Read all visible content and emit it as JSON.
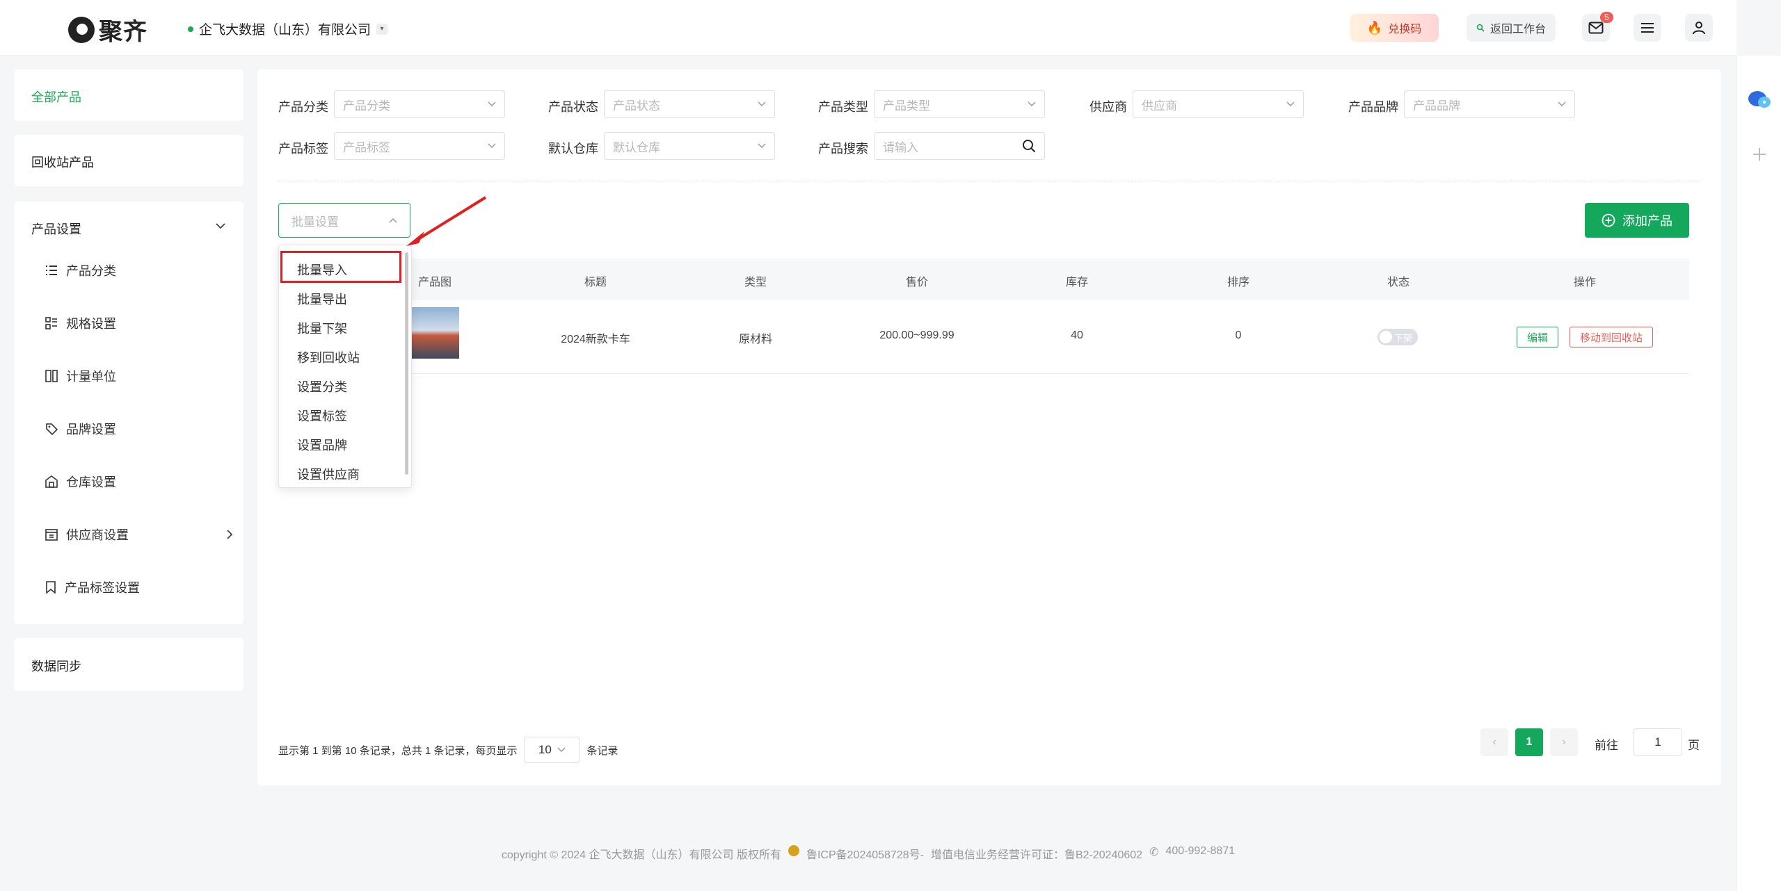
{
  "header": {
    "logo_text": "聚齐",
    "company": "企飞大数据（山东）有限公司",
    "redeem_label": "兑换码",
    "back_label": "返回工作台",
    "mail_badge": "5",
    "icons": [
      "flame-icon",
      "search-icon",
      "mail-icon",
      "menu-icon",
      "user-icon"
    ]
  },
  "sidebar": {
    "all_products": "全部产品",
    "recycle_products": "回收站产品",
    "product_settings": "产品设置",
    "settings_items": [
      {
        "label": "产品分类",
        "icon": "list-icon"
      },
      {
        "label": "规格设置",
        "icon": "spec-icon"
      },
      {
        "label": "计量单位",
        "icon": "unit-icon"
      },
      {
        "label": "品牌设置",
        "icon": "tag-icon"
      },
      {
        "label": "仓库设置",
        "icon": "warehouse-icon"
      },
      {
        "label": "供应商设置",
        "icon": "supplier-icon"
      },
      {
        "label": "产品标签设置",
        "icon": "bookmark-icon"
      }
    ],
    "data_sync": "数据同步",
    "active_color": "#1aaa55"
  },
  "filters": {
    "category": {
      "label": "产品分类",
      "placeholder": "产品分类"
    },
    "status": {
      "label": "产品状态",
      "placeholder": "产品状态"
    },
    "type": {
      "label": "产品类型",
      "placeholder": "产品类型"
    },
    "supplier": {
      "label": "供应商",
      "placeholder": "供应商"
    },
    "brand": {
      "label": "产品品牌",
      "placeholder": "产品品牌"
    },
    "tag": {
      "label": "产品标签",
      "placeholder": "产品标签"
    },
    "warehouse": {
      "label": "默认仓库",
      "placeholder": "默认仓库"
    },
    "search": {
      "label": "产品搜索",
      "placeholder": "请输入"
    }
  },
  "toolbar": {
    "batch_placeholder": "批量设置",
    "add_label": "添加产品"
  },
  "batch_menu": [
    "批量导入",
    "批量导出",
    "批量下架",
    "移到回收站",
    "设置分类",
    "设置标签",
    "设置品牌",
    "设置供应商"
  ],
  "table": {
    "headers": [
      "产品图",
      "标题",
      "类型",
      "售价",
      "库存",
      "排序",
      "状态",
      "操作"
    ],
    "rows": [
      {
        "title": "2024新款卡车",
        "type": "原材料",
        "price": "200.00~999.99",
        "stock": "40",
        "sort": "0",
        "status": "下架",
        "edit": "编辑",
        "recycle": "移动到回收站"
      }
    ]
  },
  "pagination": {
    "summary": "显示第 1 到第 10 条记录，总共 1 条记录，每页显示",
    "page_size": "10",
    "unit": "条记录",
    "current": "1",
    "goto_label": "前往",
    "goto_value": "1",
    "page_suffix": "页"
  },
  "footer": {
    "copyright": "copyright © 2024 企飞大数据（山东）有限公司 版权所有",
    "icp": "鲁ICP备2024058728号-",
    "license": "增值电信业务经营许可证：鲁B2-20240602",
    "phone": "400-992-8871"
  }
}
